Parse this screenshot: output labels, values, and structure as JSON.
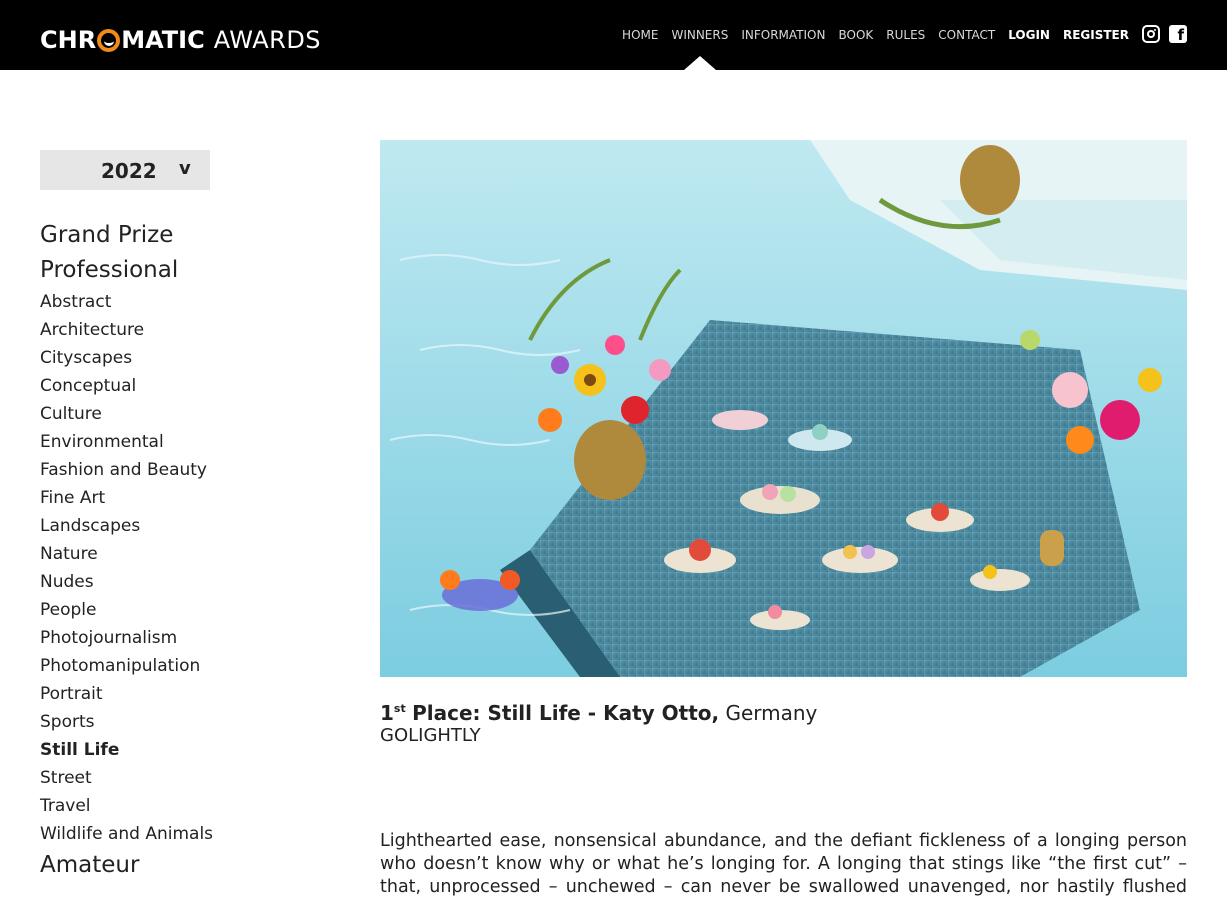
{
  "header": {
    "logo_part1": "CHR",
    "logo_part2": "MATIC",
    "logo_part3": "AWARDS",
    "nav": [
      {
        "label": "HOME",
        "active": false
      },
      {
        "label": "WINNERS",
        "active": true
      },
      {
        "label": "INFORMATION",
        "active": false
      },
      {
        "label": "BOOK",
        "active": false
      },
      {
        "label": "RULES",
        "active": false
      },
      {
        "label": "CONTACT",
        "active": false
      }
    ],
    "login_label": "LOGIN",
    "register_label": "REGISTER",
    "social": [
      "instagram-icon",
      "facebook-icon"
    ],
    "facebook_glyph": "f"
  },
  "sidebar": {
    "year": "2022",
    "year_caret": "v",
    "grand_prize": "Grand Prize",
    "professional": "Professional",
    "categories": [
      "Abstract",
      "Architecture",
      "Cityscapes",
      "Conceptual",
      "Culture",
      "Environmental",
      "Fashion and Beauty",
      "Fine Art",
      "Landscapes",
      "Nature",
      "Nudes",
      "People",
      "Photojournalism",
      "Photomanipulation",
      "Portrait",
      "Sports",
      "Still Life",
      "Street",
      "Travel",
      "Wildlife and Animals"
    ],
    "current_category": "Still Life",
    "amateur": "Amateur"
  },
  "winner": {
    "place_number": "1",
    "place_suffix": "st",
    "place_label": "Place: Still Life",
    "separator": " - ",
    "name": "Katy Otto,",
    "country": "Germany",
    "title": "GOLIGHTLY"
  },
  "description": "Lighthearted ease, nonsensical abundance, and the defiant fickleness of a longing person who doesn’t know why or what he’s longing for. A longing that stings like “the first cut” – that, unprocessed – unchewed – can never be swallowed unavenged, nor hastily flushed down, always",
  "colors": {
    "header_bg": "#000000",
    "accent_orange": "#f28a1a",
    "pool_blue": "#8fd6e6",
    "tile_blue": "#3f7f98"
  }
}
